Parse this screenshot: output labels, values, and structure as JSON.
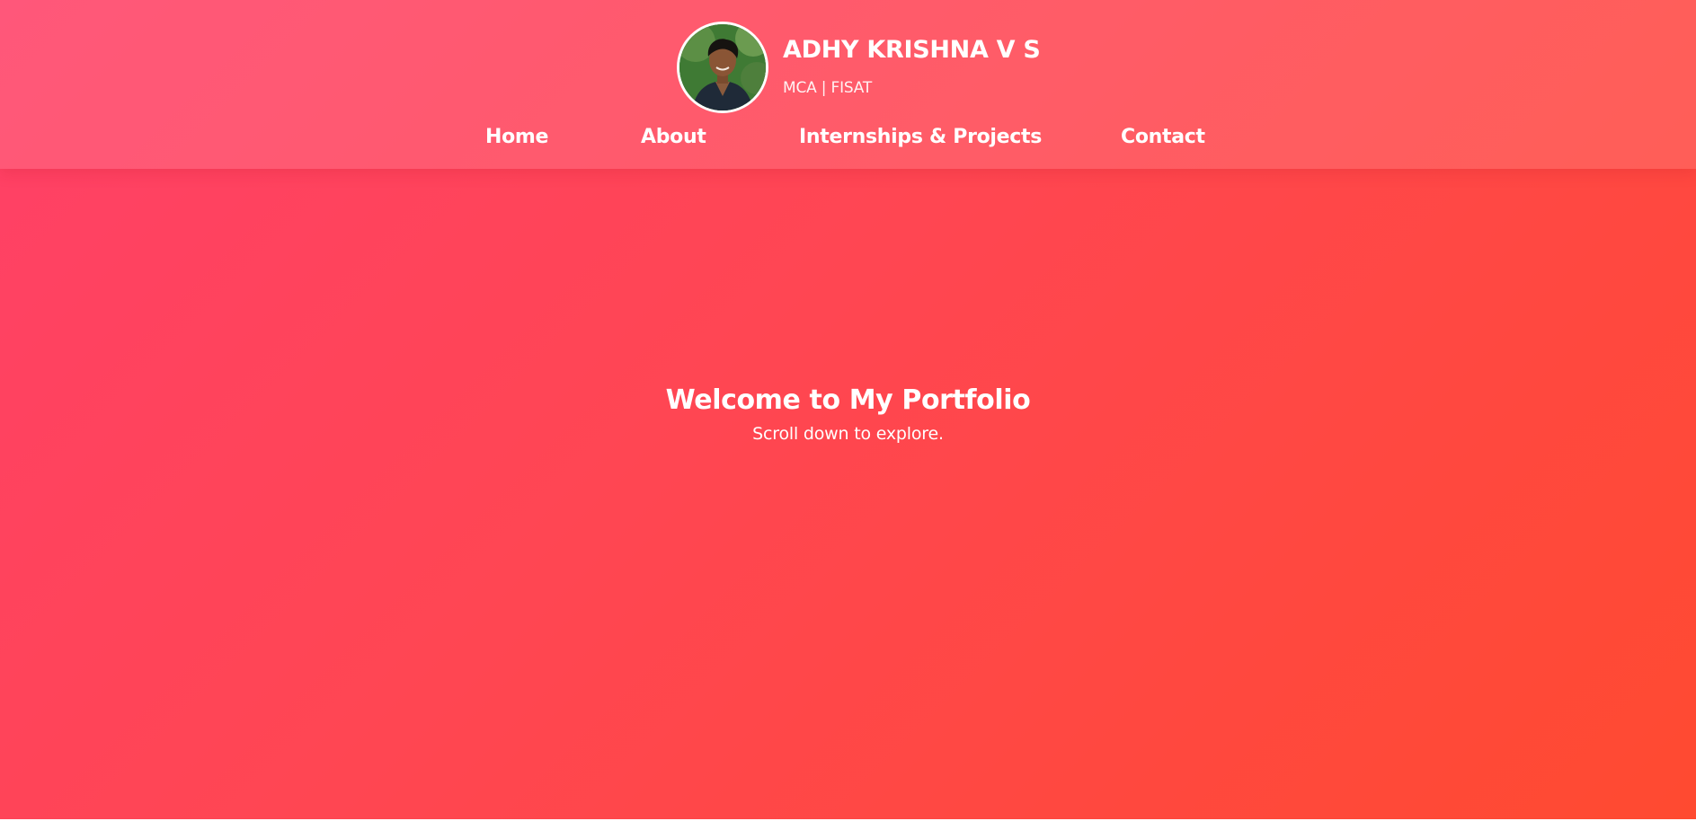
{
  "header": {
    "name": "ADHY KRISHNA V S",
    "subtitle": "MCA | FISAT",
    "avatar_icon": "profile-photo"
  },
  "nav": {
    "items": [
      {
        "label": "Home"
      },
      {
        "label": "About"
      },
      {
        "label": "Internships & Projects"
      },
      {
        "label": "Contact"
      }
    ]
  },
  "hero": {
    "title": "Welcome to My Portfolio",
    "subtitle": "Scroll down to explore."
  },
  "colors": {
    "gradient_start": "#ff4068",
    "gradient_end": "#ff4a30",
    "text": "#ffffff"
  }
}
